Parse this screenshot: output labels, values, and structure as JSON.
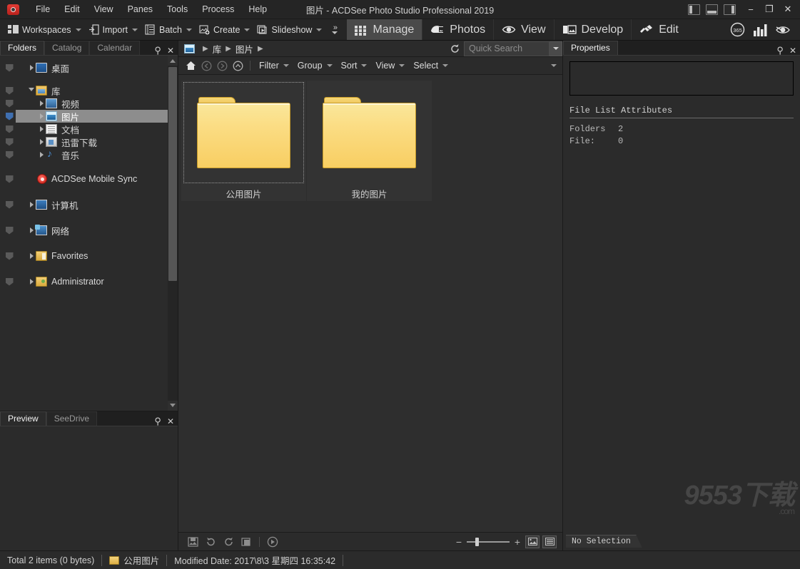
{
  "titlebar": {
    "app_icon": "camera-icon",
    "title": "图片 - ACDSee Photo Studio Professional 2019",
    "menu": [
      "File",
      "Edit",
      "View",
      "Panes",
      "Tools",
      "Process",
      "Help"
    ],
    "layout_buttons": [
      "left-pane-toggle",
      "bottom-pane-toggle",
      "right-pane-toggle"
    ],
    "window_buttons": {
      "minimize": "−",
      "maximize": "❐",
      "close": "✕"
    }
  },
  "toolbar": {
    "items": [
      {
        "label": "Workspaces",
        "icon": "workspaces-icon",
        "caret": true
      },
      {
        "label": "Import",
        "icon": "import-icon",
        "caret": true
      },
      {
        "label": "Batch",
        "icon": "batch-icon",
        "caret": true
      },
      {
        "label": "Create",
        "icon": "create-icon",
        "caret": true
      },
      {
        "label": "Slideshow",
        "icon": "slideshow-icon",
        "caret": true
      }
    ],
    "overflow": "»",
    "modes": [
      {
        "label": "Manage",
        "icon": "grid-icon",
        "active": true
      },
      {
        "label": "Photos",
        "icon": "photos-icon",
        "active": false
      },
      {
        "label": "View",
        "icon": "eye-icon",
        "active": false
      },
      {
        "label": "Develop",
        "icon": "develop-icon",
        "active": false
      },
      {
        "label": "Edit",
        "icon": "edit-brush-icon",
        "active": false
      }
    ],
    "right_icons": [
      "365-icon",
      "chart-icon",
      "eye-slash-icon"
    ]
  },
  "left_pane": {
    "tabs": [
      {
        "label": "Folders",
        "active": true
      },
      {
        "label": "Catalog",
        "active": false
      },
      {
        "label": "Calendar",
        "active": false
      }
    ],
    "pin": "pin-icon",
    "close": "✕",
    "tree": [
      {
        "label": "桌面",
        "icon": "desktop-icon",
        "indent": 1,
        "arrow": "right",
        "flag": true,
        "selected": false
      },
      {
        "label": "库",
        "icon": "library-icon",
        "indent": 1,
        "arrow": "down",
        "flag": true,
        "selected": false
      },
      {
        "label": "视频",
        "icon": "video-icon",
        "indent": 2,
        "arrow": "right",
        "flag": true,
        "selected": false
      },
      {
        "label": "图片",
        "icon": "pictures-icon",
        "indent": 2,
        "arrow": "right",
        "flag": true,
        "selected": true
      },
      {
        "label": "文档",
        "icon": "documents-icon",
        "indent": 2,
        "arrow": "right",
        "flag": true,
        "selected": false
      },
      {
        "label": "迅雷下载",
        "icon": "downloads-icon",
        "indent": 2,
        "arrow": "right",
        "flag": true,
        "selected": false
      },
      {
        "label": "音乐",
        "icon": "music-icon",
        "indent": 2,
        "arrow": "right",
        "flag": true,
        "selected": false
      },
      {
        "label": "ACDSee Mobile Sync",
        "icon": "acdsee-mobile-sync-icon",
        "indent": 1,
        "arrow": "none",
        "flag": true,
        "selected": false
      },
      {
        "label": "计算机",
        "icon": "computer-icon",
        "indent": 1,
        "arrow": "right",
        "flag": true,
        "selected": false
      },
      {
        "label": "网络",
        "icon": "network-icon",
        "indent": 1,
        "arrow": "right",
        "flag": true,
        "selected": false
      },
      {
        "label": "Favorites",
        "icon": "favorites-icon",
        "indent": 1,
        "arrow": "right",
        "flag": true,
        "selected": false
      },
      {
        "label": "Administrator",
        "icon": "user-folder-icon",
        "indent": 1,
        "arrow": "right",
        "flag": true,
        "selected": false
      }
    ],
    "bottom_tabs": [
      {
        "label": "Preview",
        "active": true
      },
      {
        "label": "SeeDrive",
        "active": false
      }
    ]
  },
  "center": {
    "breadcrumb": {
      "icon": "pictures-icon",
      "parts": [
        "库",
        "图片"
      ],
      "refresh": "refresh-icon"
    },
    "search": {
      "placeholder": "Quick Search",
      "value": ""
    },
    "filterbar": {
      "nav_icons": [
        "home-icon",
        "back-icon",
        "forward-icon",
        "up-icon"
      ],
      "menus": [
        "Filter",
        "Group",
        "Sort",
        "View",
        "Select"
      ]
    },
    "thumbnails": [
      {
        "label": "公用图片",
        "icon": "folder-icon",
        "focused": true
      },
      {
        "label": "我的图片",
        "icon": "folder-icon",
        "focused": false
      }
    ],
    "bottom_toolbar": {
      "left_icons": [
        "save-image-icon",
        "rotate-left-icon",
        "rotate-right-icon",
        "compare-icon",
        "slideshow-play-icon"
      ],
      "zoom": {
        "minus": "−",
        "plus": "+",
        "value": 20
      },
      "view_icons": [
        "thumbnail-view-icon",
        "detail-view-icon"
      ]
    }
  },
  "right_pane": {
    "tabs": [
      {
        "label": "Properties",
        "active": true
      }
    ],
    "pin": "pin-icon",
    "close": "✕",
    "section_title": "File List Attributes",
    "attributes": [
      {
        "key": "Folders",
        "value": "2"
      },
      {
        "key": "File:",
        "value": "0"
      }
    ],
    "selection_tab": "No Selection",
    "watermark": {
      "text": "9553下载",
      "sub": ".com"
    }
  },
  "statusbar": {
    "total": "Total 2 items  (0 bytes)",
    "folder_icon": "folder-icon",
    "folder_name": "公用图片",
    "modified": "Modified Date: 2017\\8\\3 星期四 16:35:42"
  },
  "colors": {
    "window_bg": "#2b2b2b",
    "toolbar_bg": "#262626",
    "title_bg": "#252525",
    "accent_selection": "#8d8d8d",
    "flag_selected": "#3f6fb0",
    "folder_yellow": "#f8ce62",
    "text": "#d8d8d8"
  }
}
